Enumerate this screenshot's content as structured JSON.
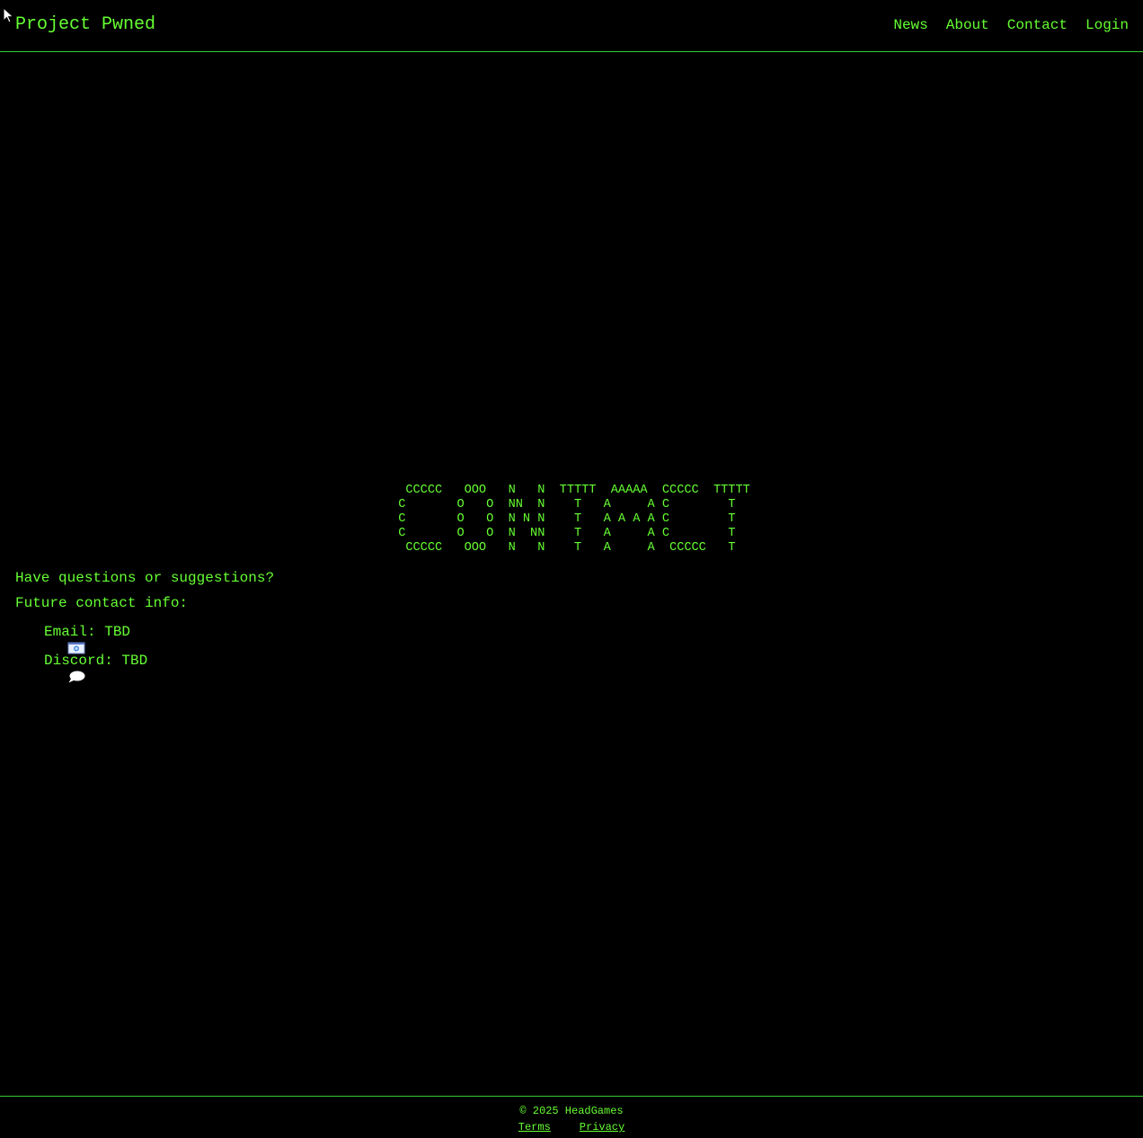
{
  "header": {
    "brand": "Project Pwned",
    "nav": [
      {
        "label": "News"
      },
      {
        "label": "About"
      },
      {
        "label": "Contact"
      },
      {
        "label": "Login"
      }
    ]
  },
  "hero": {
    "ascii_art": " CCCCC   OOO   N   N  TTTTT  AAAAA  CCCCC  TTTTT\nC       O   O  NN  N    T   A     A C        T\nC       O   O  N N N    T   A A A A C        T\nC       O   O  N  NN    T   A     A C        T\n CCCCC   OOO   N   N    T   A     A  CCCCC   T"
  },
  "contact": {
    "question": "Have questions or suggestions?",
    "future": "Future contact info:",
    "email_icon": "envelope-icon",
    "email": "Email: TBD",
    "discord_icon": "speech-bubble-icon",
    "discord": "Discord: TBD"
  },
  "footer": {
    "copyright": "© 2025 HeadGames",
    "terms": "Terms",
    "privacy": "Privacy"
  },
  "colors": {
    "background": "#000000",
    "accent": "#66ff33",
    "border": "#33cc33"
  }
}
